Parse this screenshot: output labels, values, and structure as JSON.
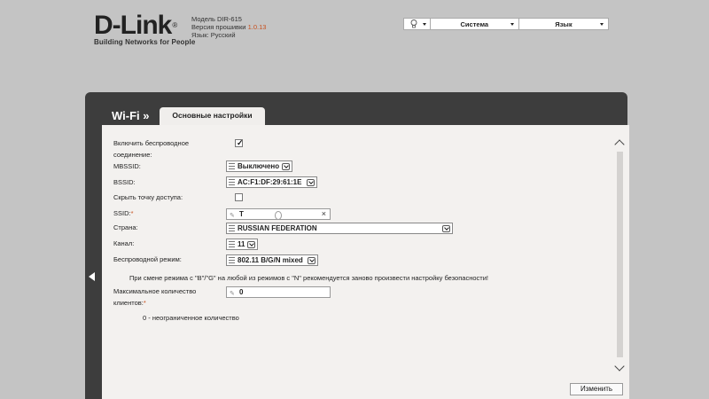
{
  "header": {
    "logo_main": "D-Link",
    "logo_tagline": "Building Networks for People",
    "model_label": "Модель DIR-615",
    "firmware_label": "Версия прошивки",
    "firmware_value": "1.0.13",
    "language_label": "Язык: Русский"
  },
  "topbar": {
    "lamp_icon": "lightbulb-icon",
    "system_label": "Система",
    "language_label": "Язык"
  },
  "panel": {
    "title": "Wi-Fi »",
    "tab_label": "Основные настройки"
  },
  "form": {
    "enable_label_1": "Включить беспроводное",
    "enable_label_2": "соединение:",
    "enable_checked": true,
    "mbssid_label": "MBSSID:",
    "mbssid_value": "Выключено",
    "bssid_label": "BSSID:",
    "bssid_value": "AC:F1:DF:29:61:1E",
    "hide_ap_label": "Скрыть точку доступа:",
    "hide_ap_checked": false,
    "ssid_label": "SSID:",
    "ssid_required": "*",
    "ssid_value": "T",
    "country_label": "Страна:",
    "country_value": "RUSSIAN FEDERATION",
    "channel_label": "Канал:",
    "channel_value": "11",
    "mode_label": "Беспроводной режим:",
    "mode_value": "802.11 B/G/N mixed",
    "mode_note": "При смене режима с \"B\"/\"G\" на любой из режимов с \"N\" рекомендуется заново произвести настройку безопасности!",
    "max_clients_label_1": "Максимальное количество",
    "max_clients_label_2": "клиентов:",
    "max_clients_required": "*",
    "max_clients_value": "0",
    "max_clients_hint": "0 - неограниченное количество"
  },
  "actions": {
    "change_button": "Изменить"
  }
}
